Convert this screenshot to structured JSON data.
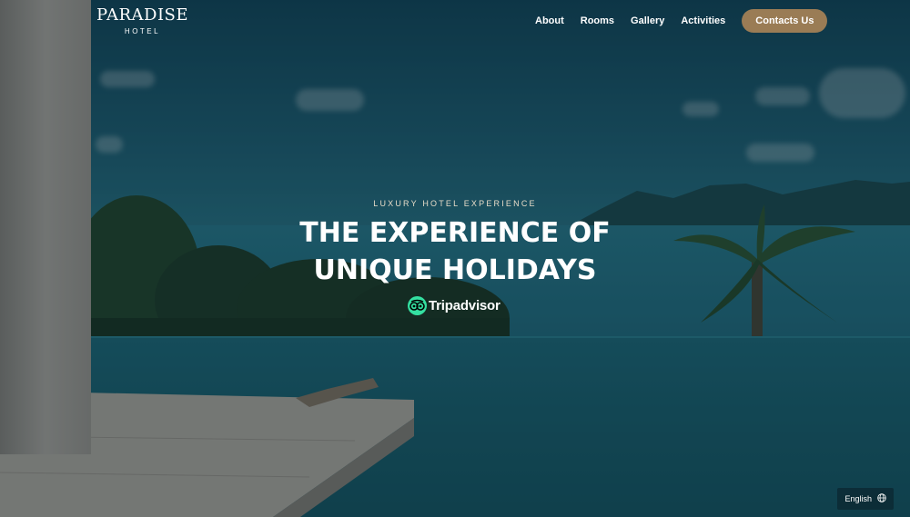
{
  "header": {
    "logo_main": "PARADISE",
    "logo_sub": "HOTEL",
    "nav": [
      {
        "label": "About"
      },
      {
        "label": "Rooms"
      },
      {
        "label": "Gallery"
      },
      {
        "label": "Activities"
      }
    ],
    "cta_label": "Contacts Us"
  },
  "hero": {
    "eyebrow": "LUXURY HOTEL EXPERIENCE",
    "headline_line1": "THE EXPERIENCE OF",
    "headline_line2": "UNIQUE HOLIDAYS",
    "tripadvisor_label": "Tripadvisor"
  },
  "language": {
    "current": "English",
    "icon": "globe-icon"
  },
  "icons": {
    "tripadvisor": "tripadvisor-owl-icon",
    "language": "globe-icon"
  },
  "colors": {
    "cta_bg": "#9a7c55",
    "eyebrow": "#e7dcc8",
    "tripadvisor_green": "#34e0a1"
  }
}
